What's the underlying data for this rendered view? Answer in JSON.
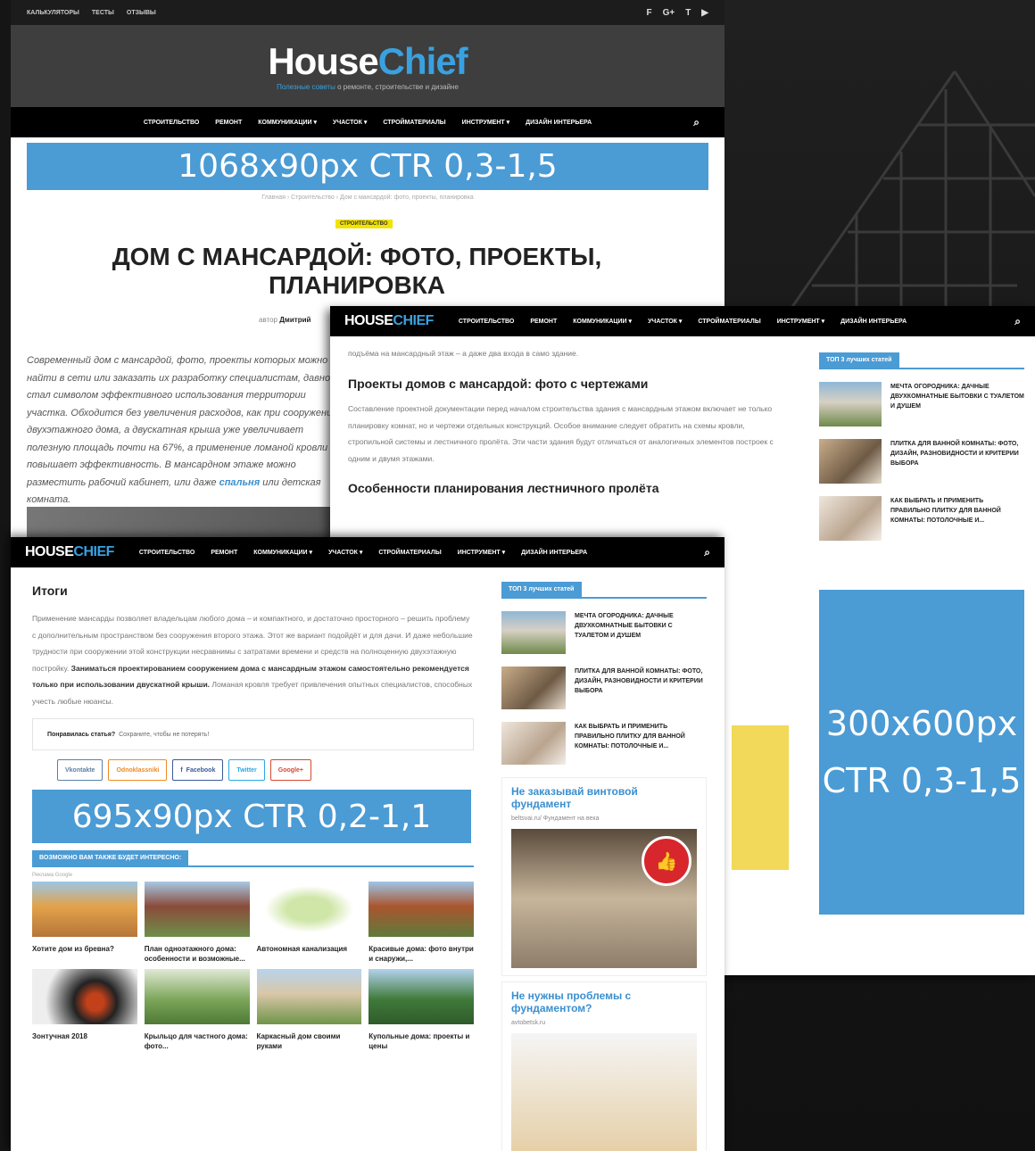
{
  "site": {
    "logo_part1": "House",
    "logo_part2": "Chief",
    "tagline_highlight": "Полезные советы",
    "tagline_rest": "о ремонте, строительстве и дизайне"
  },
  "topbar": {
    "links": [
      "Калькуляторы",
      "Тесты",
      "Отзывы"
    ],
    "social": [
      "f",
      "G+",
      "t",
      "▶"
    ]
  },
  "nav": {
    "items": [
      "Строительство",
      "Ремонт",
      "Коммуникации ▾",
      "Участок ▾",
      "Стройматериалы",
      "Инструмент ▾",
      "Дизайн интерьера"
    ],
    "search_icon": "⌕"
  },
  "ads": {
    "top": "1068x90px CTR 0,3-1,5",
    "inline": "695x90px CTR 0,2-1,1",
    "side_line1": "300x600px",
    "side_line2": "CTR 0,3-1,5"
  },
  "article": {
    "breadcrumbs": "Главная › Строительство › Дом с мансардой: фото, проекты, планировка",
    "category": "Строительство",
    "title": "Дом с мансардой: фото, проекты, планировка",
    "byline_prefix": "автор",
    "byline_author": "Дмитрий",
    "lead_text": "Современный дом с мансардой, фото, проекты которых можно найти в сети или заказать их разработку специалистам, давно стал символом эффективного использования территории участка. Обходится без увеличения расходов, как при сооружении двухэтажного дома, а двускатная крыша уже увеличивает полезную площадь почти на 67%, а применение ломаной кровли повышает эффективность. В мансардном этаже можно разместить рабочий кабинет, или даже",
    "lead_link": "спальня",
    "lead_tail": "или детская комната."
  },
  "window2": {
    "intro": "подъёма на мансардный этаж – а даже два входа в само здание.",
    "h_projects": "Проекты домов с мансардой: фото с чертежами",
    "p_projects": "Составление проектной документации перед началом строительства здания с мансардным этажом включает не только планировку комнат, но и чертежи отдельных конструкций. Особое внимание следует обратить на схемы кровли, стропильной системы и лестничного пролёта. Эти части здания будут отличаться от аналогичных элементов построек с одним и двумя этажами.",
    "h_stairs": "Особенности планирования лестничного пролёта"
  },
  "sidebar": {
    "heading": "ТОП 3 лучших статей",
    "items": [
      "Мечта огородника: дачные двухкомнатные бытовки с туалетом и душем",
      "Плитка для ванной комнаты: фото, дизайн, разновидности и критерии выбора",
      "Как выбрать и применить правильно плитку для ванной комнаты: потолочные и..."
    ]
  },
  "window3": {
    "h_summary": "Итоги",
    "summary_text": "Применение мансарды позволяет владельцам любого дома – и компактного, и достаточно просторного – решить проблему с дополнительным пространством без сооружения второго этажа. Этот же вариант подойдёт и для дачи. И даже небольшие трудности при сооружении этой конструкции несравнимы с затратами времени и средств на полноценную двухэтажную постройку.",
    "summary_bold": "Заниматься проектированием сооружением дома с мансардным этажом самостоятельно рекомендуется только при использовании двускатной крыши.",
    "summary_tail": "Ломаная кровля требует привлечения опытных специалистов, способных учесть любые нюансы.",
    "like_label": "Понравилась статья?",
    "like_text": "Сохраните, чтобы не потерять!",
    "shares": [
      "Vkontakte",
      "Odnoklassniki",
      "Facebook",
      "Twitter",
      "Google+"
    ],
    "related_heading": "Возможно вам также будет интересно:",
    "rec_note": "Реклама Google",
    "related": [
      "Хотите дом из бревна?",
      "План одноэтажного дома: особенности и возможные...",
      "Автономная канализация",
      "Красивые дома: фото внутри и снаружи,...",
      "Зонтучная 2018",
      "Крыльцо для частного дома: фото...",
      "Каркасный дом своими руками",
      "Купольные дома: проекты и цены"
    ],
    "ad_box1_q": "Не заказывай винтовой фундамент",
    "ad_box1_url": "beltsvai.ru/ Фундамент на века",
    "ad_box2_q": "Не нужны проблемы с фундаментом?",
    "ad_box2_url": "avtobetsk.ru"
  },
  "colors": {
    "accent": "#4b9bd5",
    "category_yellow": "#f2e300",
    "nav_bg": "#000000",
    "header_bg": "#3e3e3e"
  }
}
